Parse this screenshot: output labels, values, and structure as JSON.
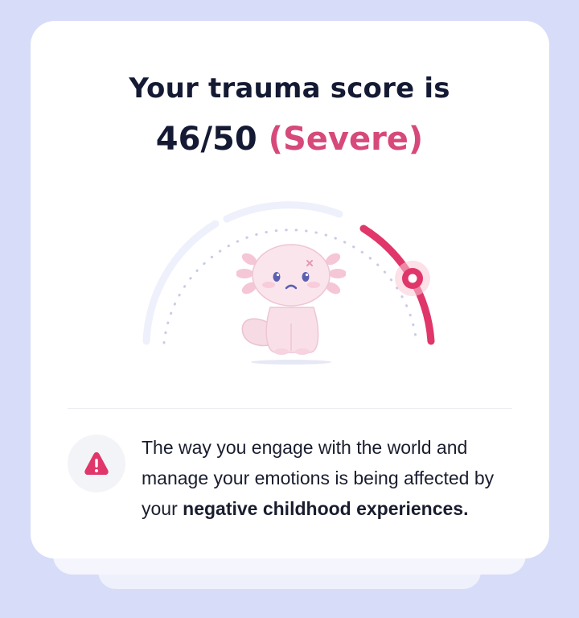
{
  "result": {
    "title": "Your trauma score is",
    "score": "46/50",
    "severity": "(Severe)",
    "score_value": 46,
    "score_max": 50
  },
  "message": {
    "text": "The way you engage with the world and manage your emotions is being affected by your ",
    "emphasis": "negative childhood experiences."
  },
  "icons": {
    "warning": "warning-icon",
    "mascot": "axolotl-mascot"
  },
  "colors": {
    "accent": "#d6497a",
    "gauge_active": "#e0366a",
    "gauge_track": "#eef0fb",
    "background": "#d7dcf8",
    "card": "#ffffff"
  }
}
